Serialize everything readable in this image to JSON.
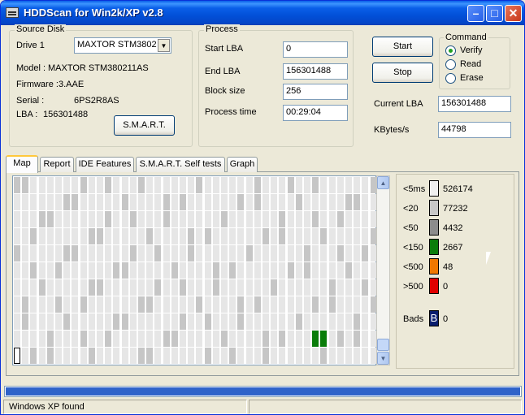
{
  "window": {
    "title": "HDDScan for Win2k/XP  v2.8"
  },
  "source_disk": {
    "group_title": "Source Disk",
    "drive_label": "Drive  1",
    "drive_selected": "MAXTOR STM3802",
    "model_label": "Model :",
    "model_value": "MAXTOR STM380211AS",
    "firmware_label": "Firmware :",
    "firmware_value": "3.AAE",
    "serial_label": "Serial :",
    "serial_value": "6PS2R8AS",
    "lba_label": "LBA :",
    "lba_value": "156301488",
    "smart_button": "S.M.A.R.T."
  },
  "process": {
    "group_title": "Process",
    "start_lba_label": "Start LBA",
    "start_lba_value": "0",
    "end_lba_label": "End LBA",
    "end_lba_value": "156301488",
    "block_size_label": "Block size",
    "block_size_value": "256",
    "process_time_label": "Process time",
    "process_time_value": "00:29:04",
    "start_button": "Start",
    "stop_button": "Stop",
    "current_lba_label": "Current LBA",
    "current_lba_value": "156301488",
    "kbytes_label": "KBytes/s",
    "kbytes_value": "44798"
  },
  "command": {
    "group_title": "Command",
    "options": [
      "Verify",
      "Read",
      "Erase"
    ],
    "selected": "Verify"
  },
  "tabs": [
    "Map",
    "Report",
    "IDE Features",
    "S.M.A.R.T. Self tests",
    "Graph"
  ],
  "active_tab": "Map",
  "legend": [
    {
      "label": "<5ms",
      "count": "526174",
      "color": "#F0F0F0"
    },
    {
      "label": "<20",
      "count": "77232",
      "color": "#C8C8C8"
    },
    {
      "label": "<50",
      "count": "4432",
      "color": "#8C8C8C"
    },
    {
      "label": "<150",
      "count": "2667",
      "color": "#0A7D0A"
    },
    {
      "label": "<500",
      "count": "48",
      "color": "#F07800"
    },
    {
      "label": ">500",
      "count": "0",
      "color": "#E00000"
    }
  ],
  "bads": {
    "label": "Bads",
    "icon_letter": "B",
    "count": "0",
    "color": "#0A1E6E"
  },
  "map_colors": {
    "light": "#E6E6E6",
    "dark": "#C6C6C6",
    "green": "#0A7D0A"
  },
  "progress_fraction": 1.0,
  "status": {
    "message": "Windows XP found",
    "secondary": ""
  }
}
